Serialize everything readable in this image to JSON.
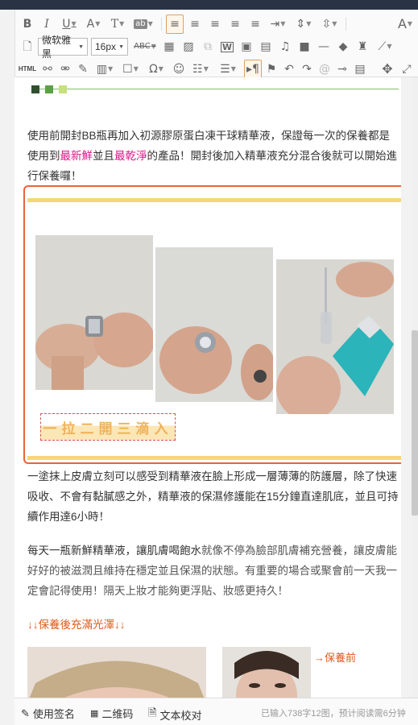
{
  "toolbar": {
    "row1": [
      {
        "name": "bold-button",
        "glyph": "B"
      },
      {
        "name": "italic-button",
        "glyph": "I"
      },
      {
        "name": "underline-button",
        "glyph": "U"
      },
      {
        "name": "font-color-button",
        "glyph": "A"
      },
      {
        "name": "text-style-button",
        "glyph": "T"
      },
      {
        "name": "highlight-button",
        "glyph": "ab"
      },
      {
        "name": "align-left-button",
        "glyph": "≡"
      },
      {
        "name": "align-center-button",
        "glyph": "≡"
      },
      {
        "name": "align-right-button",
        "glyph": "≡"
      },
      {
        "name": "align-justify-button",
        "glyph": "≡"
      },
      {
        "name": "align-distribute-button",
        "glyph": "≡"
      },
      {
        "name": "indent-button",
        "glyph": "⇥"
      },
      {
        "name": "line-height-button",
        "glyph": "⇕"
      },
      {
        "name": "paragraph-spacing-button",
        "glyph": "⇳"
      },
      {
        "name": "font-size-increase-button",
        "glyph": "A"
      }
    ],
    "font_family": "微软雅黑",
    "font_size": "16px",
    "strikethrough": "ABC",
    "html_label": "HTML",
    "footer": {
      "signature": "使用签名",
      "qrcode": "二维码",
      "proofread": "文本校对",
      "info": "已输入738字12图，预计阅读需6分钟"
    }
  },
  "divider_colors": [
    "#2f4f2f",
    "#5aa244",
    "#c6e07a"
  ],
  "content": {
    "p1_a": "使用前開封BB瓶再加入初源膠原蛋白凍干球精華液，保證每一次的保養都是使用到",
    "p1_pink1": "最新鮮",
    "p1_b": "並且",
    "p1_pink2": "最乾淨",
    "p1_c": "的產品！開封後加入精華液充分混合後就可以開始進行保養囉！",
    "caption": "一拉二開三滴入",
    "p2": "一塗抹上皮膚立刻可以感受到精華液在臉上形成一層薄薄的防護層，除了快速吸收、不會有黏膩感之外，精華液的保濕修護能在15分鐘直達肌底，並且可持續作用達6小時！",
    "p3_a": "每天一瓶新鮮精華液，讓肌膚喝飽水",
    "p3_b": "就像不停為臉部肌膚補充營養，讓皮膚能好好的被滋潤且維持在穩定並且保濕的狀態。有重要的場合或聚會前一天我一定會記得使用！隔天上妝才能夠更浮貼、妝感更持久！",
    "p4": "↓↓保養後充滿光澤↓↓",
    "before_label": "→保養前"
  },
  "accent": "#e8643a"
}
